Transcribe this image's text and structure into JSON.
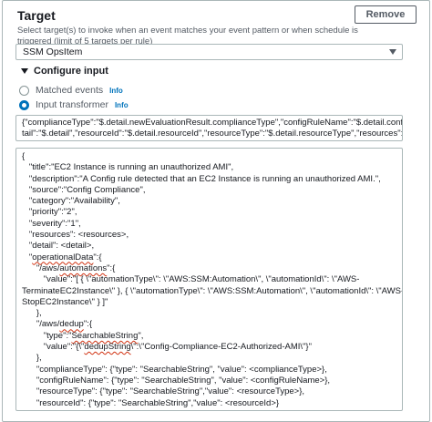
{
  "target": {
    "title": "Target",
    "description": "Select target(s) to invoke when an event matches your event pattern or when schedule is triggered (limit of 5 targets per rule)",
    "remove_label": "Remove",
    "selected_target": "SSM OpsItem"
  },
  "configure_input": {
    "heading": "Configure input",
    "options": [
      {
        "label": "Matched events",
        "info": "Info",
        "selected": false
      },
      {
        "label": "Input transformer",
        "info": "Info",
        "selected": true
      }
    ]
  },
  "input_path": {
    "lines": [
      "{\"complianceType\":\"$.detail.newEvaluationResult.complianceType\",\"configRuleName\":\"$.detail.configRuleName\",\"de",
      "tail\":\"$.detail\",\"resourceId\":\"$.detail.resourceId\",\"resourceType\":\"$.detail.resourceType\",\"resources\":\"$.resources\"}"
    ]
  },
  "input_template": {
    "lines": [
      {
        "text": "{",
        "u": ""
      },
      {
        "text": "   \"title\":\"EC2 Instance is running an unauthorized AMI\",",
        "u": ""
      },
      {
        "text": "   \"description\":\"A Config rule detected that an EC2 Instance is running an unauthorized AMI.\",",
        "u": ""
      },
      {
        "text": "   \"source\":\"Config Compliance\",",
        "u": ""
      },
      {
        "text": "   \"category\":\"Availability\",",
        "u": ""
      },
      {
        "text": "   \"priority\":\"2\",",
        "u": ""
      },
      {
        "text": "   \"severity\":\"1\",",
        "u": ""
      },
      {
        "text": "   \"resources\": <resources>,",
        "u": ""
      },
      {
        "text": "   \"detail\": <detail>,",
        "u": ""
      },
      {
        "text": "   \"operationalData\":{",
        "u": "operationalData"
      },
      {
        "text": "      \"/aws/automations\":{",
        "u": "automations"
      },
      {
        "text": "         \"value\":\"[ { \\\"automationType\\\": \\\"AWS:SSM:Automation\\\", \\\"automationId\\\": \\\"AWS-",
        "u": ""
      },
      {
        "text": "TerminateEC2Instance\\\" }, { \\\"automationType\\\": \\\"AWS:SSM:Automation\\\", \\\"automationId\\\": \\\"AWS-",
        "u": ""
      },
      {
        "text": "StopEC2Instance\\\" } ]\"",
        "u": ""
      },
      {
        "text": "      },",
        "u": ""
      },
      {
        "text": "      \"/aws/dedup\":{",
        "u": "dedup"
      },
      {
        "text": "         \"type\":\"SearchableString\",",
        "u": "SearchableString"
      },
      {
        "text": "         \"value\":\"{\\\"dedupString\\\":\\\"Config-Compliance-EC2-Authorized-AMI\\\"}\"",
        "u": "dedupString"
      },
      {
        "text": "      },",
        "u": ""
      },
      {
        "text": "      \"complianceType\": {\"type\": \"SearchableString\", \"value\": <complianceType>},",
        "u": ""
      },
      {
        "text": "      \"configRuleName\": {\"type\": \"SearchableString\", \"value\": <configRuleName>},",
        "u": ""
      },
      {
        "text": "      \"resourceType\": {\"type\": \"SearchableString\",\"value\": <resourceType>},",
        "u": ""
      },
      {
        "text": "      \"resourceId\": {\"type\": \"SearchableString\",\"value\": <resourceId>}",
        "u": ""
      },
      {
        "text": "   }",
        "u": ""
      },
      {
        "text": "}",
        "u": ""
      }
    ]
  },
  "colors": {
    "accent": "#0073bb",
    "border": "#aab7b8",
    "spell_underline": "#d13212"
  }
}
